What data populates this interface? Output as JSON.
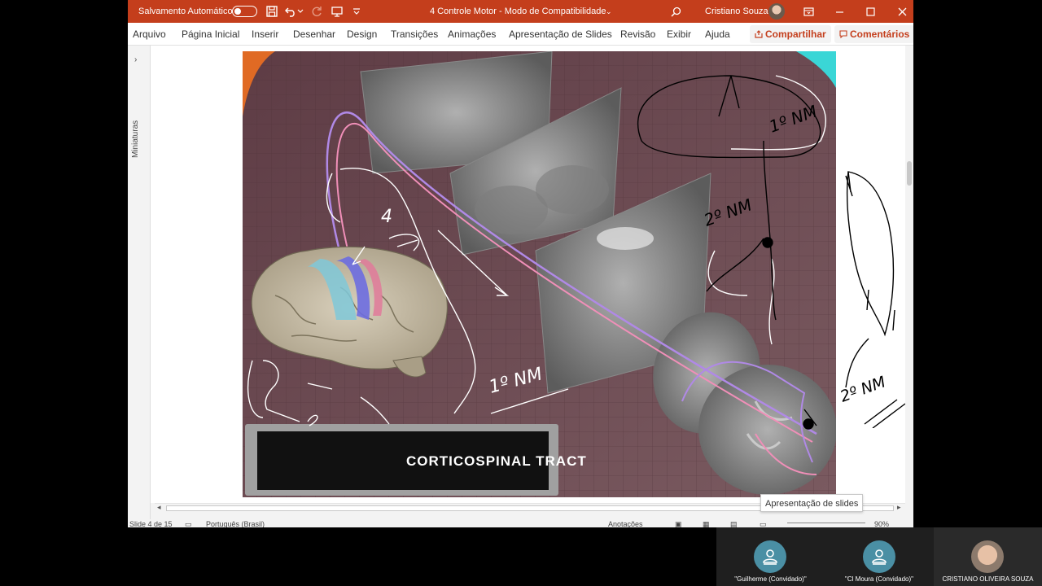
{
  "window": {
    "autosave_label": "Salvamento Automático",
    "title": "4 Controle Motor  -  Modo de Compatibilidade",
    "title_caret": "⌄",
    "user_name": "Cristiano Souza"
  },
  "ribbon": {
    "tabs": [
      "Arquivo",
      "Página Inicial",
      "Inserir",
      "Desenhar",
      "Design",
      "Transições",
      "Animações",
      "Apresentação de Slides",
      "Revisão",
      "Exibir",
      "Ajuda"
    ],
    "share_label": "Compartilhar",
    "comments_label": "Comentários"
  },
  "thumbnails_pane": {
    "label": "Miniaturas"
  },
  "slide": {
    "caption": "CORTICOSPINAL TRACT",
    "annotations": [
      "4",
      "1º NM",
      "2º NM",
      "1º NM",
      "2º NM"
    ]
  },
  "statusbar": {
    "slide_info": "Slide 4 de 15",
    "language": "Português (Brasil)",
    "notes": "Anotações",
    "zoom": "90%"
  },
  "tooltip": "Apresentação de slides",
  "participants": [
    {
      "name": "\"Guilherme (Convidado)\"",
      "avatar_color": "#4a8fa4"
    },
    {
      "name": "\"Cl Moura  (Convidado)\"",
      "avatar_color": "#4a8fa4"
    },
    {
      "name": "CRISTIANO OLIVEIRA SOUZA",
      "avatar_color": "#d9b39a"
    }
  ],
  "colors": {
    "titlebar": "#c43e1c",
    "accent": "#c43e1c",
    "slide_bg": "#6b4d55"
  }
}
